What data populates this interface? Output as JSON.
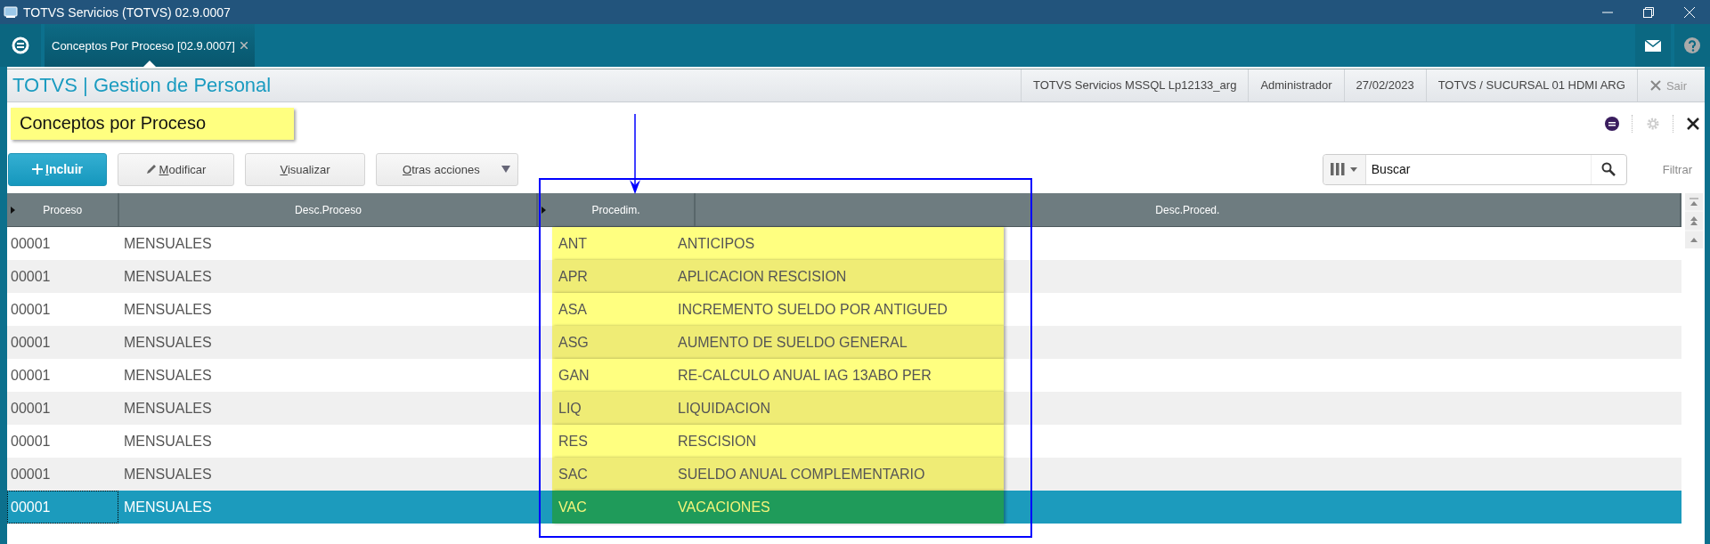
{
  "window": {
    "title": "TOTVS Servicios (TOTVS) 02.9.0007"
  },
  "tabs": [
    {
      "label": "Conceptos Por Proceso [02.9.0007]",
      "selected": true
    }
  ],
  "header": {
    "app_title": "TOTVS | Gestion de Personal",
    "info": [
      "TOTVS Servicios MSSQL Lp12133_arg",
      "Administrador",
      "27/02/2023",
      "TOTVS / SUCURSAL 01 HDMI ARG"
    ],
    "exit": "Sair"
  },
  "page_title": "Conceptos por Proceso",
  "toolbar": {
    "buttons": [
      {
        "label": "Incluir",
        "kind": "primary"
      },
      {
        "label": "Modificar",
        "kind": "edit"
      },
      {
        "label": "Visualizar",
        "kind": "plain"
      },
      {
        "label": "Otras acciones",
        "kind": "menu"
      }
    ],
    "search": {
      "value": "Buscar"
    },
    "filter": "Filtrar"
  },
  "table": {
    "columns": [
      {
        "label": "Proceso",
        "marker": true
      },
      {
        "label": "Desc.Proceso",
        "marker": false
      },
      {
        "label": "Procedim.",
        "marker": true
      },
      {
        "label": "Desc.Proced.",
        "marker": false
      }
    ],
    "rows": [
      {
        "proceso": "00001",
        "desc_proceso": "MENSUALES",
        "procedim": "ANT",
        "desc_proced": "ANTICIPOS",
        "selected": false
      },
      {
        "proceso": "00001",
        "desc_proceso": "MENSUALES",
        "procedim": "APR",
        "desc_proced": "APLICACION RESCISION",
        "selected": false
      },
      {
        "proceso": "00001",
        "desc_proceso": "MENSUALES",
        "procedim": "ASA",
        "desc_proced": "INCREMENTO SUELDO POR ANTIGUED",
        "selected": false
      },
      {
        "proceso": "00001",
        "desc_proceso": "MENSUALES",
        "procedim": "ASG",
        "desc_proced": "AUMENTO DE SUELDO GENERAL",
        "selected": false
      },
      {
        "proceso": "00001",
        "desc_proceso": "MENSUALES",
        "procedim": "GAN",
        "desc_proced": "RE-CALCULO ANUAL IAG 13ABO PER",
        "selected": false
      },
      {
        "proceso": "00001",
        "desc_proceso": "MENSUALES",
        "procedim": "LIQ",
        "desc_proced": "LIQUIDACION",
        "selected": false
      },
      {
        "proceso": "00001",
        "desc_proceso": "MENSUALES",
        "procedim": "RES",
        "desc_proced": "RESCISION",
        "selected": false
      },
      {
        "proceso": "00001",
        "desc_proceso": "MENSUALES",
        "procedim": "SAC",
        "desc_proced": "SUELDO ANUAL COMPLEMENTARIO",
        "selected": false
      },
      {
        "proceso": "00001",
        "desc_proceso": "MENSUALES",
        "procedim": "VAC",
        "desc_proced": "VACACIONES",
        "selected": true
      }
    ]
  }
}
